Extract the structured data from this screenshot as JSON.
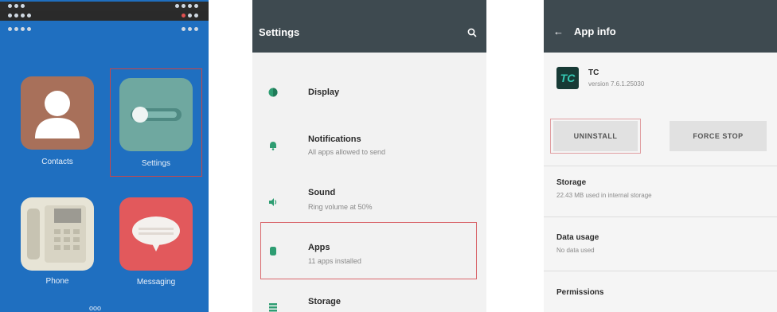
{
  "launcher": {
    "apps": [
      {
        "label": "Contacts"
      },
      {
        "label": "Settings"
      },
      {
        "label": "Phone"
      },
      {
        "label": "Messaging"
      }
    ],
    "bottom_text": "ooo"
  },
  "settings": {
    "title": "Settings",
    "items": [
      {
        "label": "Display",
        "sub": ""
      },
      {
        "label": "Notifications",
        "sub": "All apps allowed to send"
      },
      {
        "label": "Sound",
        "sub": "Ring volume at 50%"
      },
      {
        "label": "Apps",
        "sub": "11 apps installed"
      },
      {
        "label": "Storage",
        "sub": ""
      }
    ]
  },
  "app_info": {
    "title": "App info",
    "app_name": "TC",
    "app_logo_text": "TC",
    "version": "version 7.6.1.25030",
    "uninstall_label": "UNINSTALL",
    "force_stop_label": "FORCE STOP",
    "storage_title": "Storage",
    "storage_sub": "22.43 MB used in internal storage",
    "data_title": "Data usage",
    "data_sub": "No data used",
    "perm_title": "Permissions"
  },
  "colors": {
    "launcher_bg": "#1f6fc0",
    "toolbar": "#3e4a50",
    "accent": "#2e9d72",
    "highlight": "#d9666b"
  }
}
